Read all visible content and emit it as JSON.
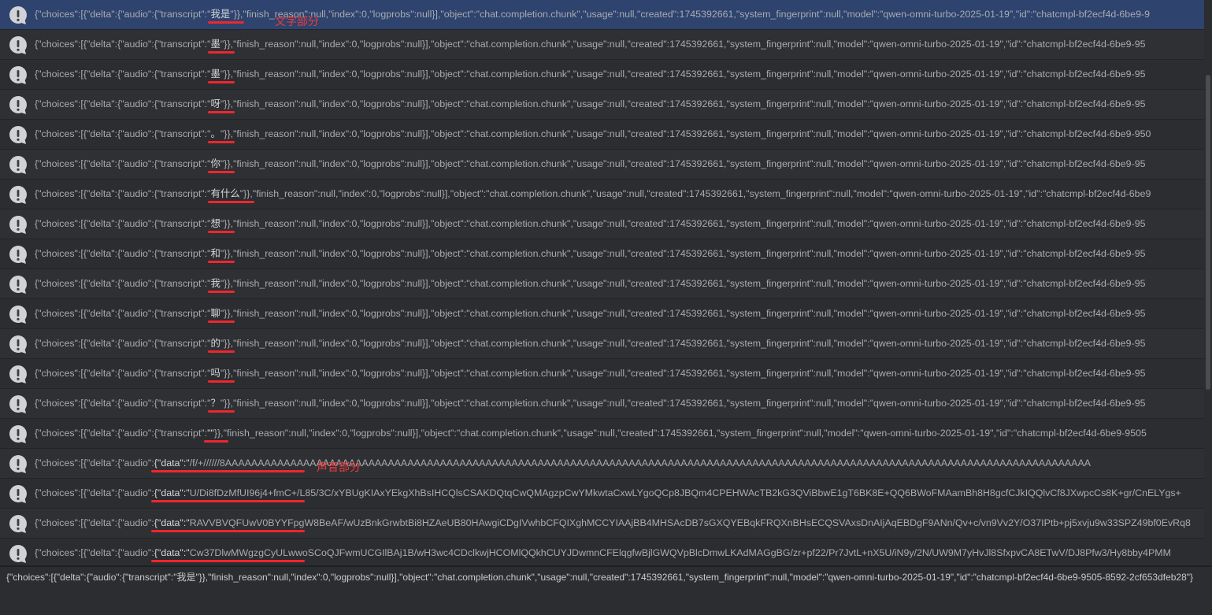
{
  "annotations": {
    "text_part": "文字部分",
    "audio_part": "声音部分"
  },
  "rows": [
    {
      "prefix": "{\"choices\":[{\"delta\":{\"audio\":{\"transcript\":\"",
      "key": "我是",
      "suffix": "\"}},\"finish_reason\":null,\"index\":0,\"logprobs\":null}],\"object\":\"chat.completion.chunk\",\"usage\":null,\"created\":1745392661,\"system_fingerprint\":null,\"model\":\"qwen-omni-turbo-2025-01-19\",\"id\":\"chatcmpl-bf2ecf4d-6be9-9"
    },
    {
      "prefix": "{\"choices\":[{\"delta\":{\"audio\":{\"transcript\":\"",
      "key": "墨",
      "suffix": "\"}},\"finish_reason\":null,\"index\":0,\"logprobs\":null}],\"object\":\"chat.completion.chunk\",\"usage\":null,\"created\":1745392661,\"system_fingerprint\":null,\"model\":\"qwen-omni-turbo-2025-01-19\",\"id\":\"chatcmpl-bf2ecf4d-6be9-95"
    },
    {
      "prefix": "{\"choices\":[{\"delta\":{\"audio\":{\"transcript\":\"",
      "key": "墨",
      "suffix": "\"}},\"finish_reason\":null,\"index\":0,\"logprobs\":null}],\"object\":\"chat.completion.chunk\",\"usage\":null,\"created\":1745392661,\"system_fingerprint\":null,\"model\":\"qwen-omni-turbo-2025-01-19\",\"id\":\"chatcmpl-bf2ecf4d-6be9-95"
    },
    {
      "prefix": "{\"choices\":[{\"delta\":{\"audio\":{\"transcript\":\"",
      "key": "呀",
      "suffix": "\"}},\"finish_reason\":null,\"index\":0,\"logprobs\":null}],\"object\":\"chat.completion.chunk\",\"usage\":null,\"created\":1745392661,\"system_fingerprint\":null,\"model\":\"qwen-omni-turbo-2025-01-19\",\"id\":\"chatcmpl-bf2ecf4d-6be9-95"
    },
    {
      "prefix": "{\"choices\":[{\"delta\":{\"audio\":{\"transcript\":\"",
      "key": "。",
      "suffix": "\"}},\"finish_reason\":null,\"index\":0,\"logprobs\":null}],\"object\":\"chat.completion.chunk\",\"usage\":null,\"created\":1745392661,\"system_fingerprint\":null,\"model\":\"qwen-omni-turbo-2025-01-19\",\"id\":\"chatcmpl-bf2ecf4d-6be9-950"
    },
    {
      "prefix": "{\"choices\":[{\"delta\":{\"audio\":{\"transcript\":\"",
      "key": "你",
      "suffix": "\"}},\"finish_reason\":null,\"index\":0,\"logprobs\":null}],\"object\":\"chat.completion.chunk\",\"usage\":null,\"created\":1745392661,\"system_fingerprint\":null,\"model\":\"qwen-omni-turbo-2025-01-19\",\"id\":\"chatcmpl-bf2ecf4d-6be9-95"
    },
    {
      "prefix": "{\"choices\":[{\"delta\":{\"audio\":{\"transcript\":\"",
      "key": "有什么",
      "suffix": "\"}},\"finish_reason\":null,\"index\":0,\"logprobs\":null}],\"object\":\"chat.completion.chunk\",\"usage\":null,\"created\":1745392661,\"system_fingerprint\":null,\"model\":\"qwen-omni-turbo-2025-01-19\",\"id\":\"chatcmpl-bf2ecf4d-6be9"
    },
    {
      "prefix": "{\"choices\":[{\"delta\":{\"audio\":{\"transcript\":\"",
      "key": "想",
      "suffix": "\"}},\"finish_reason\":null,\"index\":0,\"logprobs\":null}],\"object\":\"chat.completion.chunk\",\"usage\":null,\"created\":1745392661,\"system_fingerprint\":null,\"model\":\"qwen-omni-turbo-2025-01-19\",\"id\":\"chatcmpl-bf2ecf4d-6be9-95"
    },
    {
      "prefix": "{\"choices\":[{\"delta\":{\"audio\":{\"transcript\":\"",
      "key": "和",
      "suffix": "\"}},\"finish_reason\":null,\"index\":0,\"logprobs\":null}],\"object\":\"chat.completion.chunk\",\"usage\":null,\"created\":1745392661,\"system_fingerprint\":null,\"model\":\"qwen-omni-turbo-2025-01-19\",\"id\":\"chatcmpl-bf2ecf4d-6be9-95"
    },
    {
      "prefix": "{\"choices\":[{\"delta\":{\"audio\":{\"transcript\":\"",
      "key": "我",
      "suffix": "\"}},\"finish_reason\":null,\"index\":0,\"logprobs\":null}],\"object\":\"chat.completion.chunk\",\"usage\":null,\"created\":1745392661,\"system_fingerprint\":null,\"model\":\"qwen-omni-turbo-2025-01-19\",\"id\":\"chatcmpl-bf2ecf4d-6be9-95"
    },
    {
      "prefix": "{\"choices\":[{\"delta\":{\"audio\":{\"transcript\":\"",
      "key": "聊",
      "suffix": "\"}},\"finish_reason\":null,\"index\":0,\"logprobs\":null}],\"object\":\"chat.completion.chunk\",\"usage\":null,\"created\":1745392661,\"system_fingerprint\":null,\"model\":\"qwen-omni-turbo-2025-01-19\",\"id\":\"chatcmpl-bf2ecf4d-6be9-95"
    },
    {
      "prefix": "{\"choices\":[{\"delta\":{\"audio\":{\"transcript\":\"",
      "key": "的",
      "suffix": "\"}},\"finish_reason\":null,\"index\":0,\"logprobs\":null}],\"object\":\"chat.completion.chunk\",\"usage\":null,\"created\":1745392661,\"system_fingerprint\":null,\"model\":\"qwen-omni-turbo-2025-01-19\",\"id\":\"chatcmpl-bf2ecf4d-6be9-95"
    },
    {
      "prefix": "{\"choices\":[{\"delta\":{\"audio\":{\"transcript\":\"",
      "key": "吗",
      "suffix": "\"}},\"finish_reason\":null,\"index\":0,\"logprobs\":null}],\"object\":\"chat.completion.chunk\",\"usage\":null,\"created\":1745392661,\"system_fingerprint\":null,\"model\":\"qwen-omni-turbo-2025-01-19\",\"id\":\"chatcmpl-bf2ecf4d-6be9-95"
    },
    {
      "prefix": "{\"choices\":[{\"delta\":{\"audio\":{\"transcript\":\"",
      "key": "？",
      "suffix": "\"}},\"finish_reason\":null,\"index\":0,\"logprobs\":null}],\"object\":\"chat.completion.chunk\",\"usage\":null,\"created\":1745392661,\"system_fingerprint\":null,\"model\":\"qwen-omni-turbo-2025-01-19\",\"id\":\"chatcmpl-bf2ecf4d-6be9-95"
    },
    {
      "prefix": "{\"choices\":[{\"delta\":{\"audio\":{\"transcript\":",
      "key": "\"\"",
      "suffix": "}},\"finish_reason\":null,\"index\":0,\"logprobs\":null}],\"object\":\"chat.completion.chunk\",\"usage\":null,\"created\":1745392661,\"system_fingerprint\":null,\"model\":\"qwen-omni-turbo-2025-01-19\",\"id\":\"chatcmpl-bf2ecf4d-6be9-9505"
    },
    {
      "prefix": "{\"choices\":[{\"delta\":{\"audio\":",
      "key": "{\"data\":\"",
      "suffix": "/f/+//////8AAAAAAAAAAAAAAAAAAAAAAAAAAAAAAAAAAAAAAAAAAAAAAAAAAAAAAAAAAAAAAAAAAAAAAAAAAAAAAAAAAAAAAAAAAAAAAAAAAAAAAAAAAAAAAAAAAAAAAAAAAAAAAAAAAAAA"
    },
    {
      "prefix": "{\"choices\":[{\"delta\":{\"audio\":",
      "key": "{\"data\":\"",
      "suffix": "U/Di8fDzMfUI96j4+fmC+/L85/3C/xYBUgKIAxYEkgXhBsIHCQlsCSAKDQtqCwQMAgzpCwYMkwtaCxwLYgoQCp8JBQm4CPEHWAcTB2kG3QViBbwE1gT6BK8E+QQ6BWoFMAamBh8H8gcfCJkIQQlvCf8JXwpcCs8K+gr/CnELYgs+"
    },
    {
      "prefix": "{\"choices\":[{\"delta\":{\"audio\":",
      "key": "{\"data\":\"",
      "suffix": "RAVVBVQFUwV0BYYFpgW8BeAF/wUzBnkGrwbtBi8HZAeUB80HAwgiCDgIVwhbCFQIXghMCCYIAAjBB4MHSAcDB7sGXQYEBqkFRQXnBHsECQSVAxsDnAIjAqEBDgF9ANn/Qv+c/vn9Vv2Y/O37IPtb+pj5xvju9w33SPZ49bf0EvRq8"
    },
    {
      "prefix": "{\"choices\":[{\"delta\":{\"audio\":",
      "key": "{\"data\":\"",
      "suffix": "Cw37DlwMWgzgCyULwwoSCoQJFwmUCGIlBAj1B/wH3wc4CDclkwjHCOMlQQkhCUYJDwmnCFElqgfwBjlGWQVpBlcDmwLKAdMAGgBG/zr+pf22/Pr7JvtL+nX5U/iN9y/2N/UW9M7yHvJl8SfxpvCA8ETwV/DJ8Pfw3/Hy8bby4PMM"
    }
  ],
  "detail": "{\"choices\":[{\"delta\":{\"audio\":{\"transcript\":\"我是\"}},\"finish_reason\":null,\"index\":0,\"logprobs\":null}],\"object\":\"chat.completion.chunk\",\"usage\":null,\"created\":1745392661,\"system_fingerprint\":null,\"model\":\"qwen-omni-turbo-2025-01-19\",\"id\":\"chatcmpl-bf2ecf4d-6be9-9505-8592-2cf653dfeb28\"}"
}
